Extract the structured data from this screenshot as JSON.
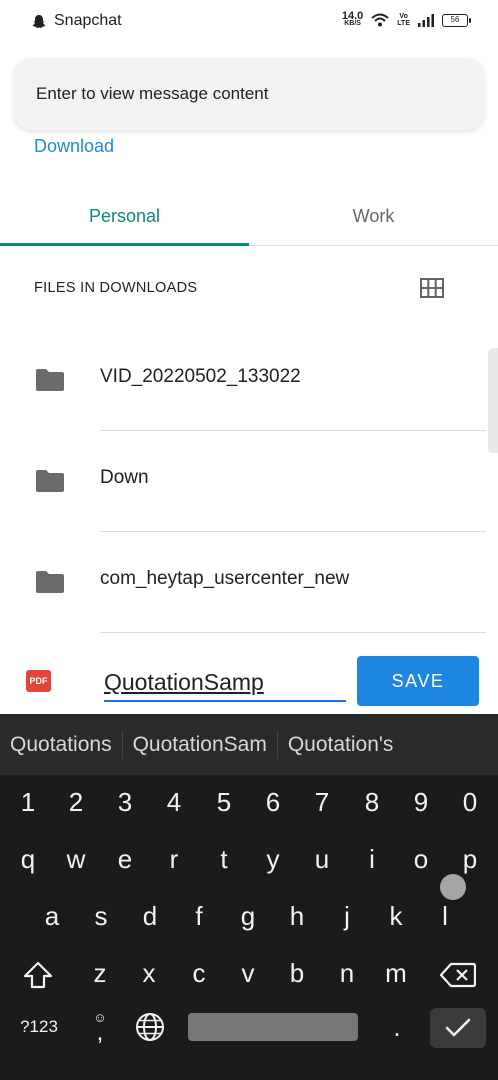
{
  "status_bar": {
    "app_name": "Snapchat",
    "net_speed": "14.0",
    "net_unit": "KB/S",
    "volte": "Vo\nLTE",
    "battery": "56"
  },
  "notification": {
    "text": "Enter to view message content"
  },
  "header": {
    "title": "Download"
  },
  "tabs": [
    {
      "label": "Personal",
      "active": true
    },
    {
      "label": "Work",
      "active": false
    }
  ],
  "section": {
    "title": "FILES IN DOWNLOADS"
  },
  "files": [
    {
      "name": "VID_20220502_133022",
      "icon": "folder-icon"
    },
    {
      "name": "Down",
      "icon": "folder-icon"
    },
    {
      "name": "com_heytap_usercenter_new",
      "icon": "folder-icon"
    }
  ],
  "save_bar": {
    "file_type_label": "PDF",
    "filename_value": "QuotationSamp",
    "save_label": "SAVE"
  },
  "keyboard": {
    "suggestions": [
      "Quotations",
      "QuotationSam",
      "Quotation's"
    ],
    "row_numbers": [
      "1",
      "2",
      "3",
      "4",
      "5",
      "6",
      "7",
      "8",
      "9",
      "0"
    ],
    "row_1": [
      "q",
      "w",
      "e",
      "r",
      "t",
      "y",
      "u",
      "i",
      "o",
      "p"
    ],
    "row_2": [
      "a",
      "s",
      "d",
      "f",
      "g",
      "h",
      "j",
      "k",
      "l"
    ],
    "row_3": [
      "z",
      "x",
      "c",
      "v",
      "b",
      "n",
      "m"
    ],
    "symbols_label": "?123",
    "comma_label": ",",
    "period_label": "."
  },
  "colors": {
    "accent_teal": "#0b8a7a",
    "link_blue": "#1a8cd8",
    "save_blue": "#1e86e0",
    "keyboard_bg": "#1b1b1b"
  }
}
